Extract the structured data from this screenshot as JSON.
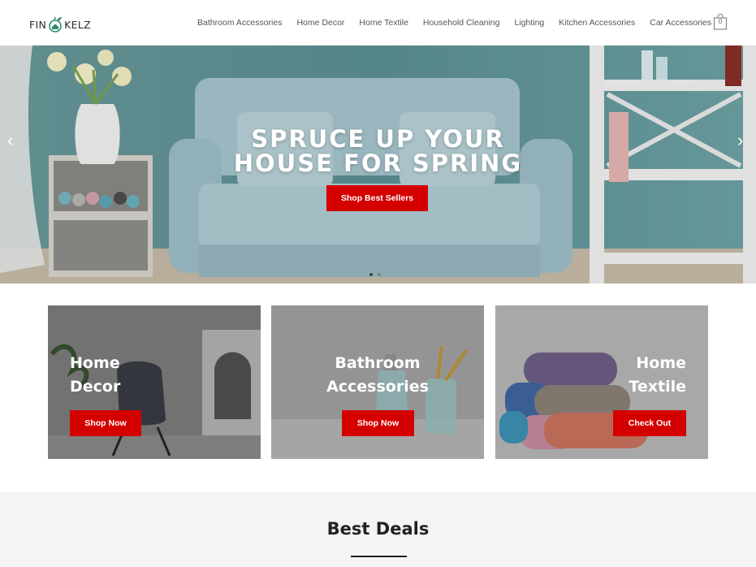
{
  "brand": {
    "name_left": "FIN",
    "name_right": "KELZ",
    "accent": "#2d8a6e"
  },
  "nav": {
    "items": [
      "Bathroom Accessories",
      "Home Decor",
      "Home Textile",
      "Household Cleaning",
      "Lighting",
      "Kitchen Accessories",
      "Car Accessories"
    ]
  },
  "cart": {
    "count": "0",
    "icon": "shopping-bag-icon"
  },
  "hero": {
    "title_line1": "SPRUCE UP YOUR",
    "title_line2": "HOUSE FOR SPRING",
    "button": "Shop Best Sellers",
    "prev_icon": "chevron-left-icon",
    "next_icon": "chevron-right-icon",
    "slides": 2,
    "active_slide": 1
  },
  "categories": [
    {
      "line1": "Home",
      "line2": "Decor",
      "button": "Shop Now"
    },
    {
      "line1": "Bathroom",
      "line2": "Accessories",
      "button": "Shop Now"
    },
    {
      "line1": "Home",
      "line2": "Textile",
      "button": "Check Out"
    }
  ],
  "deals": {
    "title": "Best Deals"
  },
  "colors": {
    "primary_button": "#d40000",
    "deals_bg": "#f4f4f4"
  }
}
